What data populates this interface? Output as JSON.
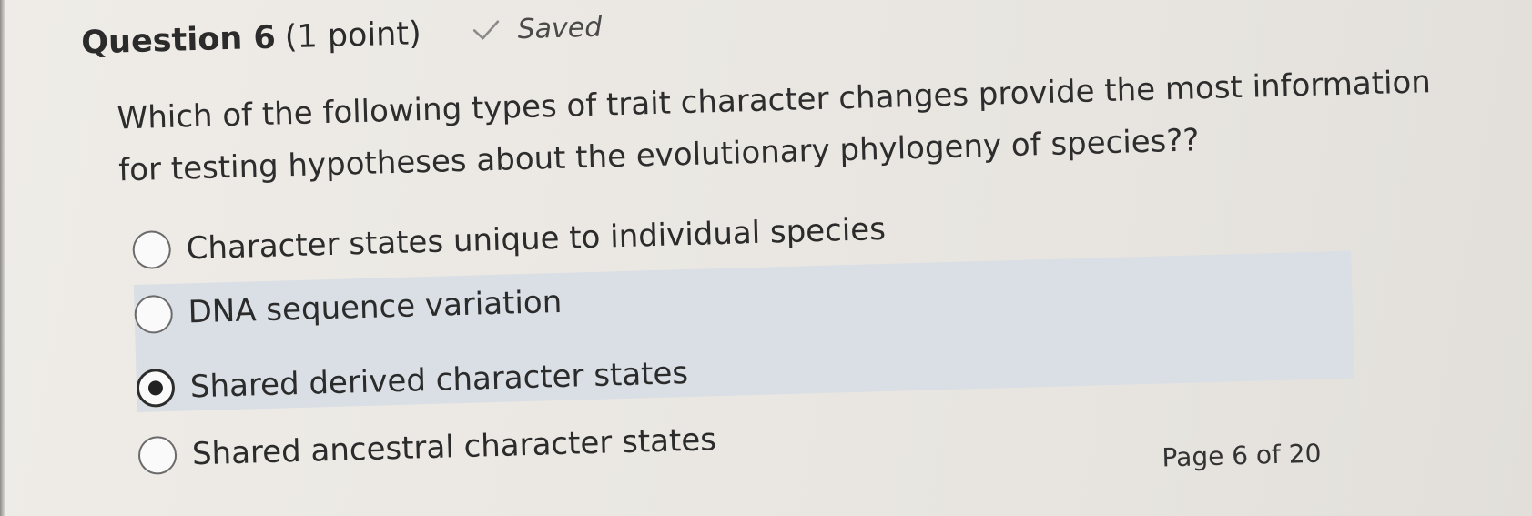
{
  "question": {
    "title": "Question 6",
    "points": "(1 point)",
    "status": "Saved",
    "status_icon": "check-icon",
    "prompt_lines": [
      "Which of the following types of trait character changes provide the most information",
      "for testing hypotheses about the evolutionary phylogeny of species??"
    ]
  },
  "options": [
    {
      "label": "Character states unique to individual species",
      "selected": false
    },
    {
      "label": "DNA sequence variation",
      "selected": false
    },
    {
      "label": "Shared derived character states",
      "selected": true
    },
    {
      "label": "Shared ancestral character states",
      "selected": false
    }
  ],
  "footer": {
    "page_indicator": "Page 6 of 20"
  },
  "colors": {
    "highlight": "#d9dfe4",
    "text": "#2b2b2b",
    "background": "#ebe8e3"
  }
}
